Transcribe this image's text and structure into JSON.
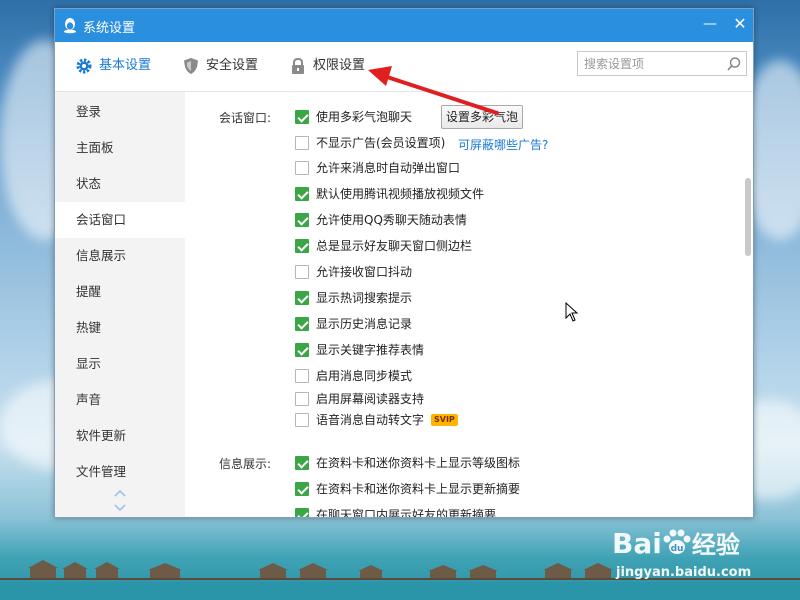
{
  "window": {
    "title": "系统设置",
    "minimize_symbol": "—",
    "close_symbol": "✕",
    "accent_color": "#2b8fe0"
  },
  "toolbar": {
    "tabs": [
      {
        "label": "基本设置",
        "icon": "gear-icon",
        "active": true
      },
      {
        "label": "安全设置",
        "icon": "shield-icon",
        "active": false
      },
      {
        "label": "权限设置",
        "icon": "lock-icon",
        "active": false
      }
    ],
    "search_placeholder": "搜索设置项"
  },
  "sidebar": {
    "items": [
      {
        "label": "登录"
      },
      {
        "label": "主面板"
      },
      {
        "label": "状态"
      },
      {
        "label": "会话窗口",
        "active": true
      },
      {
        "label": "信息展示"
      },
      {
        "label": "提醒"
      },
      {
        "label": "热键"
      },
      {
        "label": "显示"
      },
      {
        "label": "声音"
      },
      {
        "label": "软件更新"
      },
      {
        "label": "文件管理"
      }
    ]
  },
  "content": {
    "session_window": {
      "label": "会话窗口:",
      "bubble_button": "设置多彩气泡",
      "ads_link": "可屏蔽哪些广告?",
      "svip_badge": "SVIP",
      "options": [
        {
          "text": "使用多彩气泡聊天",
          "checked": true
        },
        {
          "text": "不显示广告(会员设置项)",
          "checked": false
        },
        {
          "text": "允许来消息时自动弹出窗口",
          "checked": false
        },
        {
          "text": "默认使用腾讯视频播放视频文件",
          "checked": true
        },
        {
          "text": "允许使用QQ秀聊天随动表情",
          "checked": true
        },
        {
          "text": "总是显示好友聊天窗口侧边栏",
          "checked": true
        },
        {
          "text": "允许接收窗口抖动",
          "checked": false
        },
        {
          "text": "显示热词搜索提示",
          "checked": true
        },
        {
          "text": "显示历史消息记录",
          "checked": true
        },
        {
          "text": "显示关键字推荐表情",
          "checked": true
        },
        {
          "text": "启用消息同步模式",
          "checked": false
        },
        {
          "text": "启用屏幕阅读器支持",
          "checked": false
        },
        {
          "text": "语音消息自动转文字",
          "checked": false
        }
      ]
    },
    "info_display": {
      "label": "信息展示:",
      "options": [
        {
          "text": "在资料卡和迷你资料卡上显示等级图标",
          "checked": true
        },
        {
          "text": "在资料卡和迷你资料卡上显示更新摘要",
          "checked": true
        },
        {
          "text": "在聊天窗口内展示好友的更新摘要",
          "checked": true
        }
      ]
    }
  },
  "watermark": {
    "brand_latin_1": "Bai",
    "brand_latin_2": "du",
    "brand_cn": "经验",
    "url": "jingyan.baidu.com"
  },
  "annotation": {
    "color": "#e02020"
  }
}
